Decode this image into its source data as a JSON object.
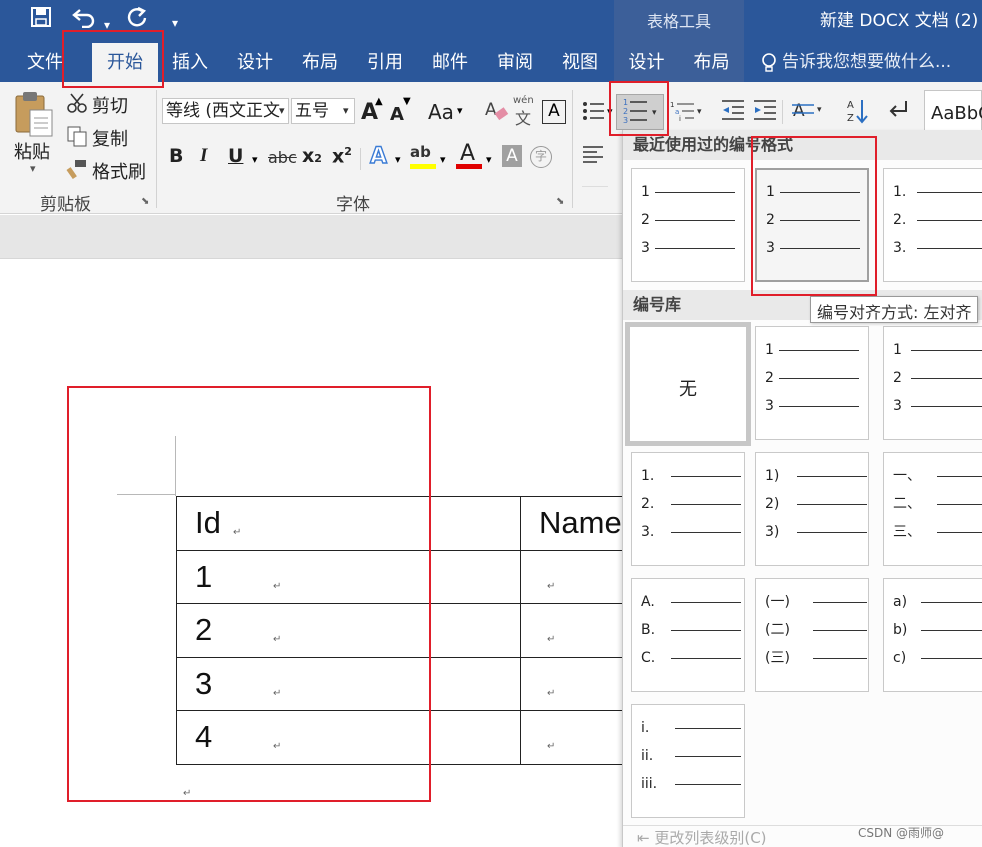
{
  "titlebar": {
    "save_icon": "save-icon",
    "undo_icon": "undo-icon",
    "redo_icon": "redo-icon",
    "customize_icon": "customize-qat-icon",
    "table_tools": "表格工具",
    "doc_title": "新建 DOCX 文档 (2)"
  },
  "tabs": {
    "file": "文件",
    "home": "开始",
    "insert": "插入",
    "design": "设计",
    "layout": "布局",
    "references": "引用",
    "mailings": "邮件",
    "review": "审阅",
    "view": "视图",
    "table_design": "设计",
    "table_layout": "布局",
    "tell_me": "告诉我您想要做什么..."
  },
  "ribbon": {
    "clipboard": {
      "paste": "粘贴",
      "cut": "剪切",
      "copy": "复制",
      "format_painter": "格式刷",
      "group": "剪贴板"
    },
    "font": {
      "font_name": "等线 (西文正文",
      "font_size": "五号",
      "group": "字体",
      "grow": "A",
      "shrink": "A",
      "case": "Aa",
      "pinyin_top": "wén",
      "pinyin_char": "文",
      "border_char": "A",
      "bold": "B",
      "italic": "I",
      "underline": "U",
      "strike": "abc",
      "subscript": "x",
      "sub_mark": "2",
      "superscript": "x",
      "sup_mark": "2",
      "text_effect": "A",
      "highlight": "ab",
      "font_color": "A",
      "shade": "A",
      "enclose": "字"
    },
    "style_preview": "AaBbC",
    "colors": {
      "accent": "#2b579a",
      "highlight_yellow": "#ffff00",
      "font_red": "#e00000"
    }
  },
  "document": {
    "table": {
      "headers": [
        "Id",
        "Name"
      ],
      "rows": [
        [
          "1",
          ""
        ],
        [
          "2",
          ""
        ],
        [
          "3",
          ""
        ],
        [
          "4",
          ""
        ]
      ]
    },
    "paragraph_mark": "↵"
  },
  "numbering_dropdown": {
    "recent_heading": "最近使用过的编号格式",
    "library_heading": "编号库",
    "none_label": "无",
    "footer": "更改列表级别(C)",
    "recent": [
      [
        "1",
        "2",
        "3"
      ],
      [
        "1",
        "2",
        "3"
      ],
      [
        "1.",
        "2.",
        "3."
      ]
    ],
    "library": [
      [
        "1",
        "2",
        "3"
      ],
      [
        "1",
        "2",
        "3"
      ],
      [
        "1.",
        "2.",
        "3."
      ],
      [
        "1)",
        "2)",
        "3)"
      ],
      [
        "一、",
        "二、",
        "三、"
      ],
      [
        "A.",
        "B.",
        "C."
      ],
      [
        "(一)",
        "(二)",
        "(三)"
      ],
      [
        "a)",
        "b)",
        "c)"
      ],
      [
        "i.",
        "ii.",
        "iii."
      ]
    ],
    "tooltip": "编号对齐方式: 左对齐"
  },
  "watermark": "CSDN @雨师@"
}
